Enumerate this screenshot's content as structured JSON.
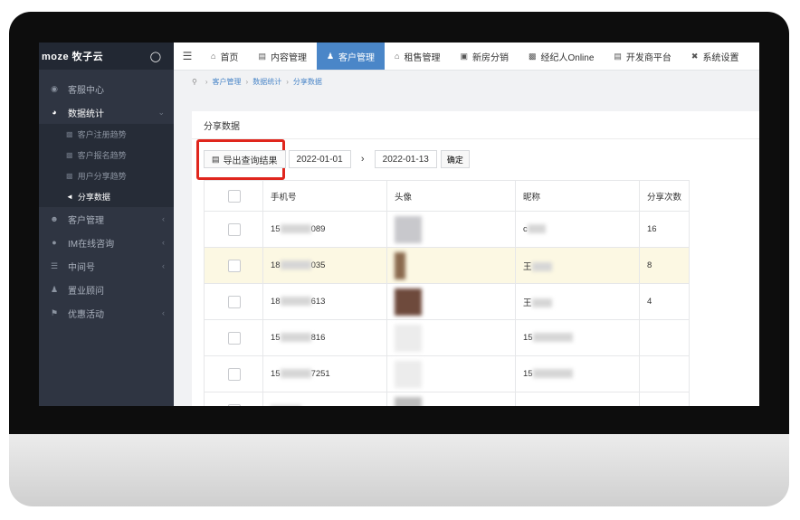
{
  "brand": {
    "name": "moze 牧子云"
  },
  "sidebar": {
    "items": [
      {
        "label": "客服中心",
        "icon": "eye-icon",
        "open": false
      },
      {
        "label": "数据统计",
        "icon": "pie-chart-icon",
        "open": true,
        "children": [
          {
            "label": "客户注册趋势",
            "icon": "bar-chart-icon",
            "active": false
          },
          {
            "label": "客户报名趋势",
            "icon": "bar-chart-icon",
            "active": false
          },
          {
            "label": "用户分享趋势",
            "icon": "bar-chart-icon",
            "active": false
          },
          {
            "label": "分享数据",
            "icon": "share-icon",
            "active": true
          }
        ]
      },
      {
        "label": "客户管理",
        "icon": "users-icon",
        "open": false
      },
      {
        "label": "IM在线咨询",
        "icon": "chat-icon",
        "open": false
      },
      {
        "label": "中间号",
        "icon": "list-icon",
        "open": false
      },
      {
        "label": "置业顾问",
        "icon": "user-icon",
        "open": false
      },
      {
        "label": "优惠活动",
        "icon": "flag-icon",
        "open": false
      }
    ]
  },
  "topnav": {
    "tabs": [
      {
        "label": "首页",
        "icon": "home-icon",
        "active": false
      },
      {
        "label": "内容管理",
        "icon": "document-icon",
        "active": false
      },
      {
        "label": "客户管理",
        "icon": "user-plus-icon",
        "active": true
      },
      {
        "label": "租售管理",
        "icon": "home-icon",
        "active": false
      },
      {
        "label": "新房分销",
        "icon": "card-icon",
        "active": false
      },
      {
        "label": "经纪人Online",
        "icon": "id-card-icon",
        "active": false
      },
      {
        "label": "开发商平台",
        "icon": "document-icon",
        "active": false
      },
      {
        "label": "系统设置",
        "icon": "settings-icon",
        "active": false
      }
    ]
  },
  "breadcrumb": [
    "客户管理",
    "数据统计",
    "分享数据"
  ],
  "panel": {
    "title": "分享数据"
  },
  "toolbar": {
    "export_label": "导出查询结果",
    "start_date": "2022-01-01",
    "end_date": "2022-01-13",
    "confirm_label": "确定"
  },
  "table": {
    "headers": [
      "手机号",
      "头像",
      "昵称",
      "分享次数"
    ],
    "rows": [
      {
        "phone_start": "15",
        "phone_end": "089",
        "nick_start": "c",
        "shares": "16",
        "highlight": false
      },
      {
        "phone_start": "18",
        "phone_end": "035",
        "nick_start": "王",
        "shares": "8",
        "highlight": true
      },
      {
        "phone_start": "18",
        "phone_end": "613",
        "nick_start": "王",
        "shares": "4",
        "highlight": false
      },
      {
        "phone_start": "15",
        "phone_end": "816",
        "nick_start": "15",
        "shares": "",
        "highlight": false
      },
      {
        "phone_start": "15",
        "phone_end": "7251",
        "nick_start": "15",
        "shares": "",
        "highlight": false
      },
      {
        "phone_start": "",
        "phone_end": "",
        "nick_start": "",
        "shares": "",
        "highlight": false
      }
    ]
  }
}
